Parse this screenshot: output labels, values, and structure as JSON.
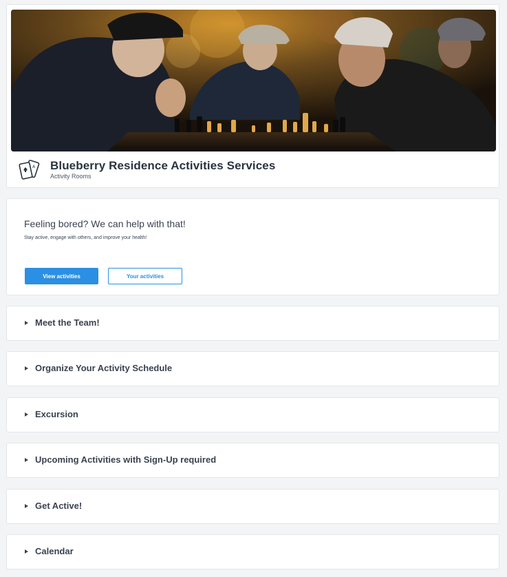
{
  "header": {
    "banner_alt": "Seniors playing chess in a park",
    "title": "Blueberry Residence Activities Services",
    "subtitle": "Activity Rooms",
    "icon": "playing-cards-icon"
  },
  "promo": {
    "heading": "Feeling bored? We can help with that!",
    "subtext": "Stay active, engage with others, and improve your health!",
    "primary_button": "View activities",
    "secondary_button": "Your activities"
  },
  "sections": [
    {
      "label": "Meet the Team!"
    },
    {
      "label": "Organize Your Activity Schedule"
    },
    {
      "label": "Excursion"
    },
    {
      "label": "Upcoming Activities with Sign-Up required"
    },
    {
      "label": "Get Active!"
    },
    {
      "label": "Calendar"
    }
  ],
  "colors": {
    "accent": "#2b8fe3",
    "text": "#3a4250",
    "background": "#f3f4f6"
  }
}
